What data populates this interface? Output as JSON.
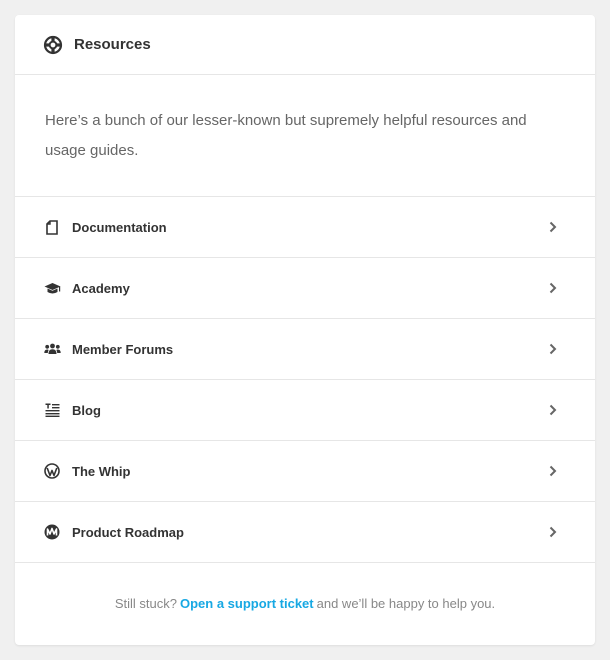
{
  "header": {
    "title": "Resources",
    "icon": "life-ring-icon"
  },
  "intro": {
    "text": "Here’s a bunch of our lesser-known but supremely helpful resources and usage guides."
  },
  "items": [
    {
      "label": "Documentation",
      "icon": "document-icon"
    },
    {
      "label": "Academy",
      "icon": "graduation-cap-icon"
    },
    {
      "label": "Member Forums",
      "icon": "users-icon"
    },
    {
      "label": "Blog",
      "icon": "blog-icon"
    },
    {
      "label": "The Whip",
      "icon": "wordpress-icon"
    },
    {
      "label": "Product Roadmap",
      "icon": "roadmap-icon"
    }
  ],
  "footer": {
    "prefix": "Still stuck?",
    "link": "Open a support ticket",
    "suffix": "and we’ll be happy to help you."
  },
  "colors": {
    "accent": "#17a8e3",
    "text": "#333333",
    "muted": "#666666",
    "background": "#f0f0f0"
  }
}
